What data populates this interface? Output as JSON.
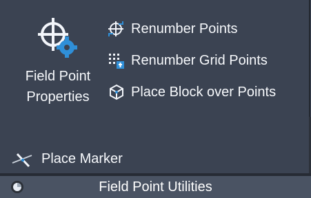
{
  "large_button": {
    "line1": "Field Point",
    "line2": "Properties",
    "icon": "field-point-properties-icon"
  },
  "buttons": [
    {
      "label": "Renumber Points",
      "icon": "renumber-points-icon"
    },
    {
      "label": "Renumber Grid Points",
      "icon": "renumber-grid-points-icon"
    },
    {
      "label": "Place Block over Points",
      "icon": "place-block-icon"
    }
  ],
  "bottom_button": {
    "label": "Place Marker",
    "icon": "place-marker-icon"
  },
  "panel": {
    "title": "Field Point Utilities"
  },
  "colors": {
    "background": "#3b4352",
    "accent": "#2f8fd8"
  }
}
